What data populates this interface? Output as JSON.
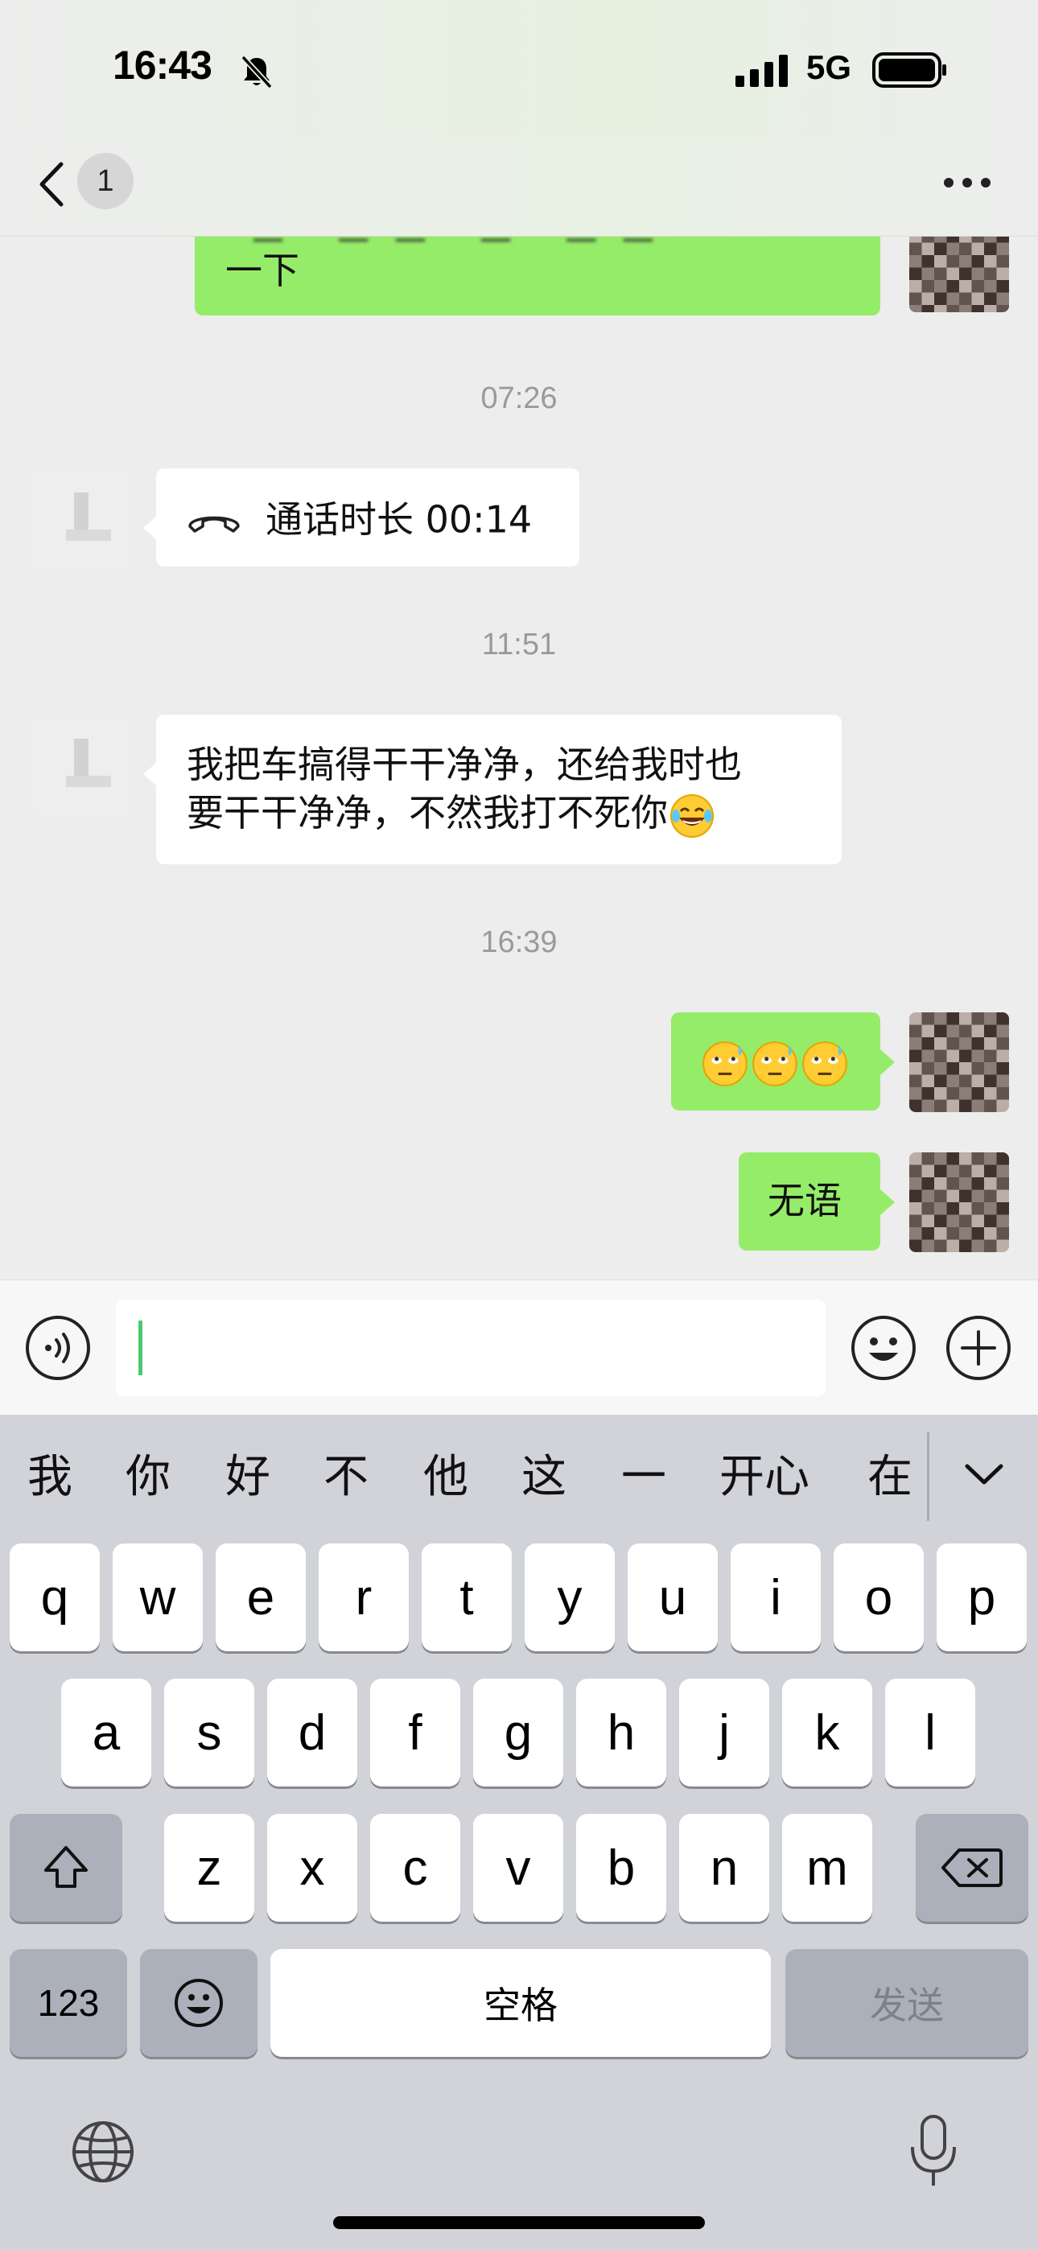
{
  "status_bar": {
    "time": "16:43",
    "network": "5G",
    "icons": [
      "bell-muted-icon",
      "signal-icon",
      "battery-icon"
    ]
  },
  "nav": {
    "unread_count": "1",
    "title": "",
    "icons": [
      "chevron-left-icon",
      "more-icon"
    ]
  },
  "messages": [
    {
      "type": "text",
      "side": "right",
      "text": "一下"
    },
    {
      "type": "timestamp",
      "text": "07:26"
    },
    {
      "type": "call",
      "side": "left",
      "text": "通话时长 00:14"
    },
    {
      "type": "timestamp",
      "text": "11:51"
    },
    {
      "type": "text",
      "side": "left",
      "lines": [
        "我把车搞得干干净净，还给我时也",
        "要干干净净，不然我打不死你"
      ],
      "emoji": "laughing-tears-emoji"
    },
    {
      "type": "timestamp",
      "text": "16:39"
    },
    {
      "type": "emoji",
      "side": "right",
      "emoji": "rolling-eyes-sweat-emoji",
      "count": 3
    },
    {
      "type": "text",
      "side": "right",
      "text": "无语"
    }
  ],
  "input_bar": {
    "value": "",
    "icons": [
      "voice-icon",
      "emoji-icon",
      "plus-icon"
    ]
  },
  "keyboard": {
    "candidates": [
      "我",
      "你",
      "好",
      "不",
      "他",
      "这",
      "一",
      "开心",
      "在"
    ],
    "row1": [
      "q",
      "w",
      "e",
      "r",
      "t",
      "y",
      "u",
      "i",
      "o",
      "p"
    ],
    "row2": [
      "a",
      "s",
      "d",
      "f",
      "g",
      "h",
      "j",
      "k",
      "l"
    ],
    "row3": [
      "z",
      "x",
      "c",
      "v",
      "b",
      "n",
      "m"
    ],
    "num_label": "123",
    "space_label": "空格",
    "send_label": "发送",
    "icons": [
      "shift-icon",
      "backspace-icon",
      "emoji-key-icon",
      "globe-icon",
      "mic-icon",
      "chevron-down-icon"
    ]
  },
  "colors": {
    "sent_bubble": "#95ec69",
    "received_bubble": "#ffffff",
    "chat_bg": "#ededed",
    "keyboard_bg": "#d1d3d9"
  }
}
